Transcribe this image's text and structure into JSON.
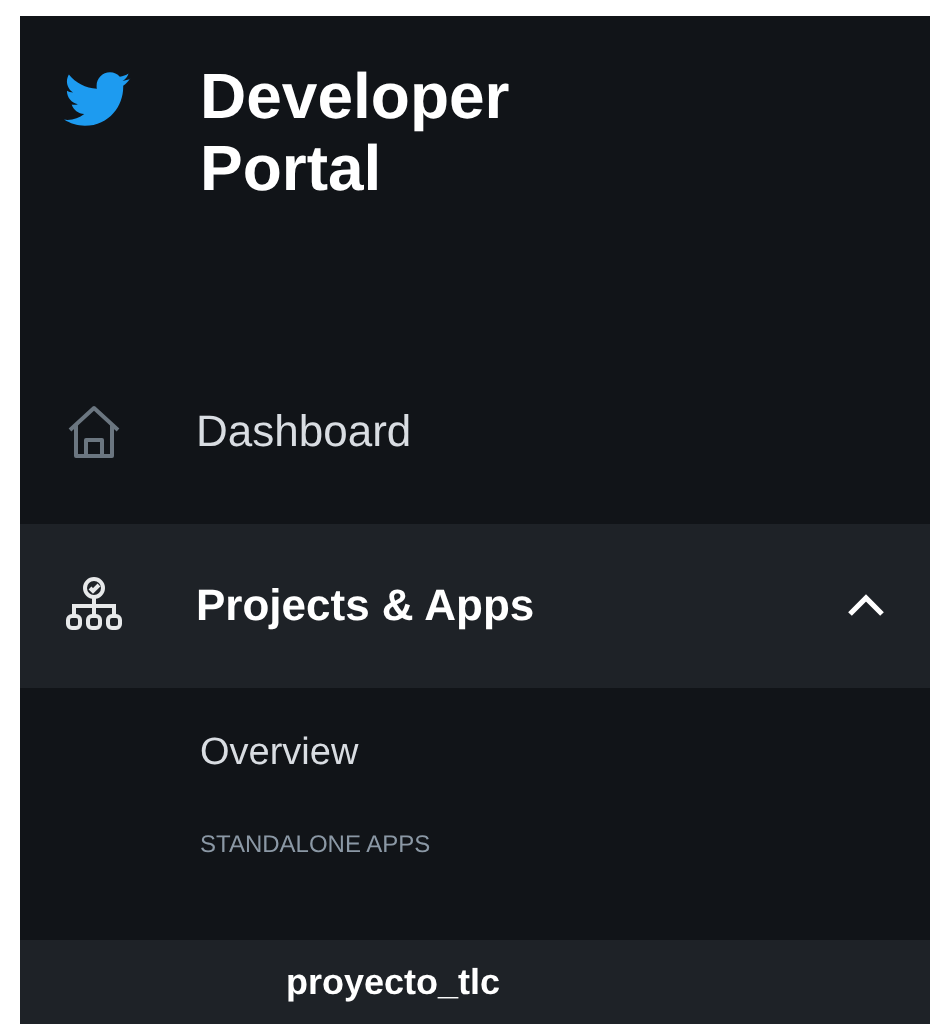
{
  "header": {
    "title": "Developer Portal"
  },
  "nav": [
    {
      "label": "Dashboard",
      "kind": "link",
      "selected": false
    },
    {
      "label": "Projects & Apps",
      "kind": "group",
      "selected": true,
      "expanded": true,
      "children": [
        {
          "kind": "link",
          "label": "Overview",
          "selected": false
        },
        {
          "kind": "section",
          "label": "STANDALONE APPS"
        },
        {
          "kind": "app",
          "label": "proyecto_tlc",
          "selected": true
        }
      ]
    }
  ]
}
